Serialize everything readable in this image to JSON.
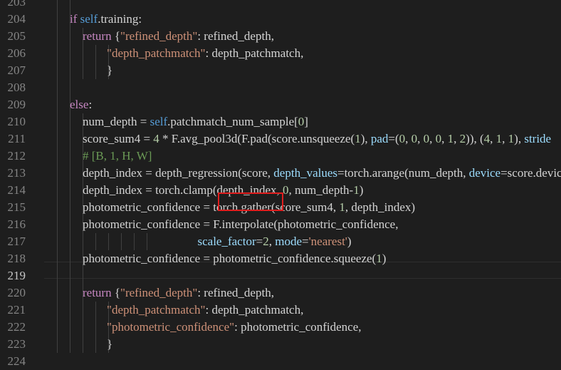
{
  "editor": {
    "lines": [
      {
        "num": "203",
        "indent": 3,
        "tokens": []
      },
      {
        "num": "204",
        "indent": 3,
        "tokens": [
          {
            "c": "kw-ctrl",
            "t": "if "
          },
          {
            "c": "kw",
            "t": "self"
          },
          {
            "c": "txt",
            "t": ".training:"
          }
        ]
      },
      {
        "num": "205",
        "indent": 4,
        "tokens": [
          {
            "c": "kw-ctrl",
            "t": "return "
          },
          {
            "c": "txt",
            "t": "{"
          },
          {
            "c": "str",
            "t": "\"refined_depth\""
          },
          {
            "c": "txt",
            "t": ": refined_depth,"
          }
        ]
      },
      {
        "num": "206",
        "indent": 4,
        "extra_guides": 2,
        "tokens": [
          {
            "c": "str",
            "t": "        \"depth_patchmatch\""
          },
          {
            "c": "txt",
            "t": ": depth_patchmatch,"
          }
        ]
      },
      {
        "num": "207",
        "indent": 4,
        "extra_guides": 2,
        "tokens": [
          {
            "c": "txt",
            "t": "        }"
          }
        ]
      },
      {
        "num": "208",
        "indent": 3,
        "tokens": []
      },
      {
        "num": "209",
        "indent": 3,
        "tokens": [
          {
            "c": "kw-ctrl",
            "t": "else"
          },
          {
            "c": "txt",
            "t": ":"
          }
        ]
      },
      {
        "num": "210",
        "indent": 4,
        "tokens": [
          {
            "c": "txt",
            "t": "num_depth = "
          },
          {
            "c": "kw",
            "t": "self"
          },
          {
            "c": "txt",
            "t": ".patchmatch_num_sample["
          },
          {
            "c": "num",
            "t": "0"
          },
          {
            "c": "txt",
            "t": "]"
          }
        ]
      },
      {
        "num": "211",
        "indent": 4,
        "tokens": [
          {
            "c": "txt",
            "t": "score_sum4 = "
          },
          {
            "c": "num",
            "t": "4"
          },
          {
            "c": "txt",
            "t": " * F.avg_pool3d(F.pad(score.unsqueeze("
          },
          {
            "c": "num",
            "t": "1"
          },
          {
            "c": "txt",
            "t": "), "
          },
          {
            "c": "param",
            "t": "pad"
          },
          {
            "c": "txt",
            "t": "=("
          },
          {
            "c": "num",
            "t": "0"
          },
          {
            "c": "txt",
            "t": ", "
          },
          {
            "c": "num",
            "t": "0"
          },
          {
            "c": "txt",
            "t": ", "
          },
          {
            "c": "num",
            "t": "0"
          },
          {
            "c": "txt",
            "t": ", "
          },
          {
            "c": "num",
            "t": "0"
          },
          {
            "c": "txt",
            "t": ", "
          },
          {
            "c": "num",
            "t": "1"
          },
          {
            "c": "txt",
            "t": ", "
          },
          {
            "c": "num",
            "t": "2"
          },
          {
            "c": "txt",
            "t": ")), ("
          },
          {
            "c": "num",
            "t": "4"
          },
          {
            "c": "txt",
            "t": ", "
          },
          {
            "c": "num",
            "t": "1"
          },
          {
            "c": "txt",
            "t": ", "
          },
          {
            "c": "num",
            "t": "1"
          },
          {
            "c": "txt",
            "t": "), "
          },
          {
            "c": "param",
            "t": "stride"
          }
        ]
      },
      {
        "num": "212",
        "indent": 4,
        "tokens": [
          {
            "c": "cmt",
            "t": "# [B, 1, H, W]"
          }
        ]
      },
      {
        "num": "213",
        "indent": 4,
        "tokens": [
          {
            "c": "txt",
            "t": "depth_index = depth_regression(score, "
          },
          {
            "c": "param",
            "t": "depth_values"
          },
          {
            "c": "txt",
            "t": "=torch.arange(num_depth, "
          },
          {
            "c": "param",
            "t": "device"
          },
          {
            "c": "txt",
            "t": "=score.device"
          }
        ]
      },
      {
        "num": "214",
        "indent": 4,
        "tokens": [
          {
            "c": "txt",
            "t": "depth_index = torch.clamp(depth_index, "
          },
          {
            "c": "num",
            "t": "0"
          },
          {
            "c": "txt",
            "t": ", num_depth-"
          },
          {
            "c": "num",
            "t": "1"
          },
          {
            "c": "txt",
            "t": ")"
          }
        ]
      },
      {
        "num": "215",
        "indent": 4,
        "tokens": [
          {
            "c": "txt",
            "t": "photometric_confidence = torch.gather(score_sum4, "
          },
          {
            "c": "num",
            "t": "1"
          },
          {
            "c": "txt",
            "t": ", depth_index)"
          }
        ]
      },
      {
        "num": "216",
        "indent": 4,
        "tokens": [
          {
            "c": "txt",
            "t": "photometric_confidence = F.interpolate(photometric_confidence,"
          }
        ]
      },
      {
        "num": "217",
        "indent": 4,
        "extra_guides": 5,
        "tokens": [
          {
            "c": "txt",
            "t": "                                      "
          },
          {
            "c": "param",
            "t": "scale_factor"
          },
          {
            "c": "txt",
            "t": "="
          },
          {
            "c": "num",
            "t": "2"
          },
          {
            "c": "txt",
            "t": ", "
          },
          {
            "c": "param",
            "t": "mode"
          },
          {
            "c": "txt",
            "t": "="
          },
          {
            "c": "str",
            "t": "'nearest'"
          },
          {
            "c": "txt",
            "t": ")"
          }
        ]
      },
      {
        "num": "218",
        "indent": 4,
        "tokens": [
          {
            "c": "txt",
            "t": "photometric_confidence = photometric_confidence.squeeze("
          },
          {
            "c": "num",
            "t": "1"
          },
          {
            "c": "txt",
            "t": ")"
          }
        ]
      },
      {
        "num": "219",
        "indent": 4,
        "tokens": [],
        "active": true
      },
      {
        "num": "220",
        "indent": 4,
        "tokens": [
          {
            "c": "kw-ctrl",
            "t": "return "
          },
          {
            "c": "txt",
            "t": "{"
          },
          {
            "c": "str",
            "t": "\"refined_depth\""
          },
          {
            "c": "txt",
            "t": ": refined_depth,"
          }
        ]
      },
      {
        "num": "221",
        "indent": 4,
        "extra_guides": 2,
        "tokens": [
          {
            "c": "str",
            "t": "        \"depth_patchmatch\""
          },
          {
            "c": "txt",
            "t": ": depth_patchmatch,"
          }
        ]
      },
      {
        "num": "222",
        "indent": 4,
        "extra_guides": 2,
        "tokens": [
          {
            "c": "str",
            "t": "        \"photometric_confidence\""
          },
          {
            "c": "txt",
            "t": ": photometric_confidence,"
          }
        ]
      },
      {
        "num": "223",
        "indent": 4,
        "extra_guides": 2,
        "tokens": [
          {
            "c": "txt",
            "t": "        }"
          }
        ]
      },
      {
        "num": "224",
        "indent": 0,
        "tokens": []
      }
    ]
  },
  "highlight": {
    "label": "torch.gather",
    "color": "#e01e1e"
  }
}
